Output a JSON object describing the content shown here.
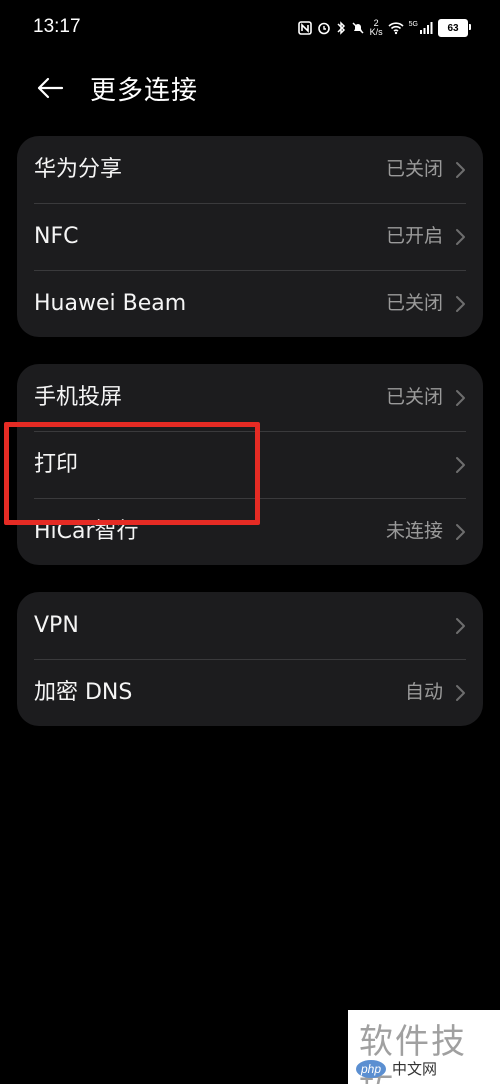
{
  "status_bar": {
    "time": "13:17",
    "speed_value": "2",
    "speed_unit": "K/s",
    "network": "5G",
    "battery": "63"
  },
  "header": {
    "title": "更多连接"
  },
  "groups": [
    {
      "rows": [
        {
          "label": "华为分享",
          "value": "已关闭"
        },
        {
          "label": "NFC",
          "value": "已开启"
        },
        {
          "label": "Huawei Beam",
          "value": "已关闭"
        }
      ]
    },
    {
      "rows": [
        {
          "label": "手机投屏",
          "value": "已关闭"
        },
        {
          "label": "打印",
          "value": ""
        },
        {
          "label": "HiCar智行",
          "value": "未连接"
        }
      ]
    },
    {
      "rows": [
        {
          "label": "VPN",
          "value": ""
        },
        {
          "label": "加密 DNS",
          "value": "自动"
        }
      ]
    }
  ],
  "watermark": {
    "text": "软件技巧",
    "logo_php": "php",
    "logo_cn": "中文网"
  },
  "colors": {
    "background": "#000000",
    "card": "#1c1c1e",
    "divider": "#3a3a3c",
    "value_text": "#9a9a9a",
    "highlight": "#e52b24"
  }
}
